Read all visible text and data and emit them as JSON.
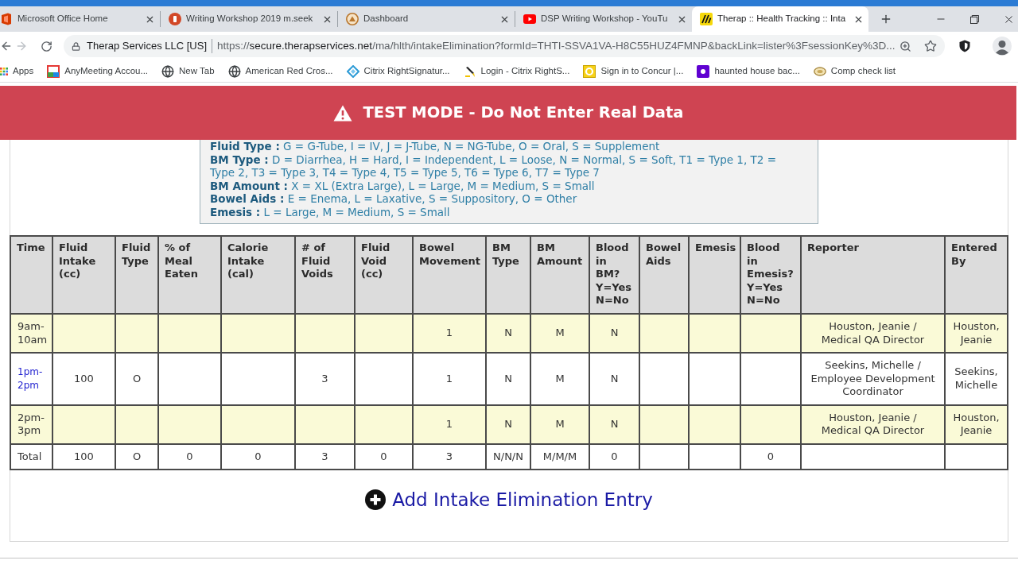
{
  "browser": {
    "tabs": [
      {
        "title": "Microsoft Office Home",
        "selected": false
      },
      {
        "title": "Writing Workshop 2019 m.seek",
        "selected": false
      },
      {
        "title": "Dashboard",
        "selected": false
      },
      {
        "title": "DSP Writing Workshop - YouTu",
        "selected": false
      },
      {
        "title": "Therap :: Health Tracking :: Inta",
        "selected": true
      }
    ],
    "nav": {
      "back": {
        "disabled": false
      },
      "forward": {
        "disabled": true
      }
    },
    "address": {
      "site_name": "Therap Services LLC [US]",
      "url_scheme": "https://",
      "url_host": "secure.therapservices.net",
      "url_rest": "/ma/hlth/intakeElimination?formId=THTI-SSVA1VA-H8C55HUZ4FMNP&backLink=lister%3FsessionKey%3D..."
    },
    "bookmarks": [
      "Apps",
      "AnyMeeting Accou...",
      "New Tab",
      "American Red Cros...",
      "Citrix RightSignatur...",
      "Login - Citrix RightS...",
      "Sign in to Concur |...",
      "haunted house bac...",
      "Comp check list"
    ]
  },
  "banner": {
    "text": "TEST MODE - Do Not Enter Real Data"
  },
  "legend": [
    {
      "label": "Fluid Type :",
      "text": "G = G-Tube, I = IV, J = J-Tube, N = NG-Tube, O = Oral, S = Supplement"
    },
    {
      "label": "BM Type :",
      "text": "D = Diarrhea, H = Hard, I = Independent, L = Loose, N = Normal, S = Soft, T1 = Type 1, T2 = Type 2, T3 = Type 3, T4 = Type 4, T5 = Type 5, T6 = Type 6, T7 = Type 7"
    },
    {
      "label": "BM Amount :",
      "text": "X = XL (Extra Large), L = Large, M = Medium, S = Small"
    },
    {
      "label": "Bowel Aids :",
      "text": "E = Enema, L = Laxative, S = Suppository, O = Other"
    },
    {
      "label": "Emesis :",
      "text": "L = Large, M = Medium, S = Small"
    }
  ],
  "table": {
    "columns": [
      "Time",
      "Fluid Intake (cc)",
      "Fluid Type",
      "% of Meal Eaten",
      "Calorie Intake (cal)",
      "# of Fluid Voids",
      "Fluid Void (cc)",
      "Bowel Movement",
      "BM Type",
      "BM Amount",
      "Blood in BM? Y=Yes N=No",
      "Bowel Aids",
      "Emesis",
      "Blood in Emesis? Y=Yes N=No",
      "Reporter",
      "Entered By"
    ],
    "rows": [
      {
        "highlighted": true,
        "time_link": false,
        "cells": {
          "time": "9am-10am",
          "bowel_movement": "1",
          "bm_type": "N",
          "bm_amount": "M",
          "blood_in_bm": "N",
          "reporter": "Houston, Jeanie / Medical QA Director",
          "entered_by": "Houston, Jeanie"
        }
      },
      {
        "highlighted": false,
        "time_link": true,
        "cells": {
          "time": "1pm-2pm",
          "fluid_intake": "100",
          "fluid_type": "O",
          "fluid_voids": "3",
          "bowel_movement": "1",
          "bm_type": "N",
          "bm_amount": "M",
          "blood_in_bm": "N",
          "reporter": "Seekins, Michelle / Employee Development Coordinator",
          "entered_by": "Seekins, Michelle"
        }
      },
      {
        "highlighted": true,
        "time_link": false,
        "cells": {
          "time": "2pm-3pm",
          "bowel_movement": "1",
          "bm_type": "N",
          "bm_amount": "M",
          "blood_in_bm": "N",
          "reporter": "Houston, Jeanie / Medical QA Director",
          "entered_by": "Houston, Jeanie"
        }
      }
    ],
    "total": {
      "time": "Total",
      "fluid_intake": "100",
      "fluid_type": "O",
      "meal_eaten": "0",
      "calorie_intake": "0",
      "fluid_voids": "3",
      "fluid_void": "0",
      "bowel_movement": "3",
      "bm_type": "N/N/N",
      "bm_amount": "M/M/M",
      "blood_in_bm": "0",
      "blood_in_emesis": "0"
    }
  },
  "add_entry_link": "Add Intake Elimination Entry"
}
